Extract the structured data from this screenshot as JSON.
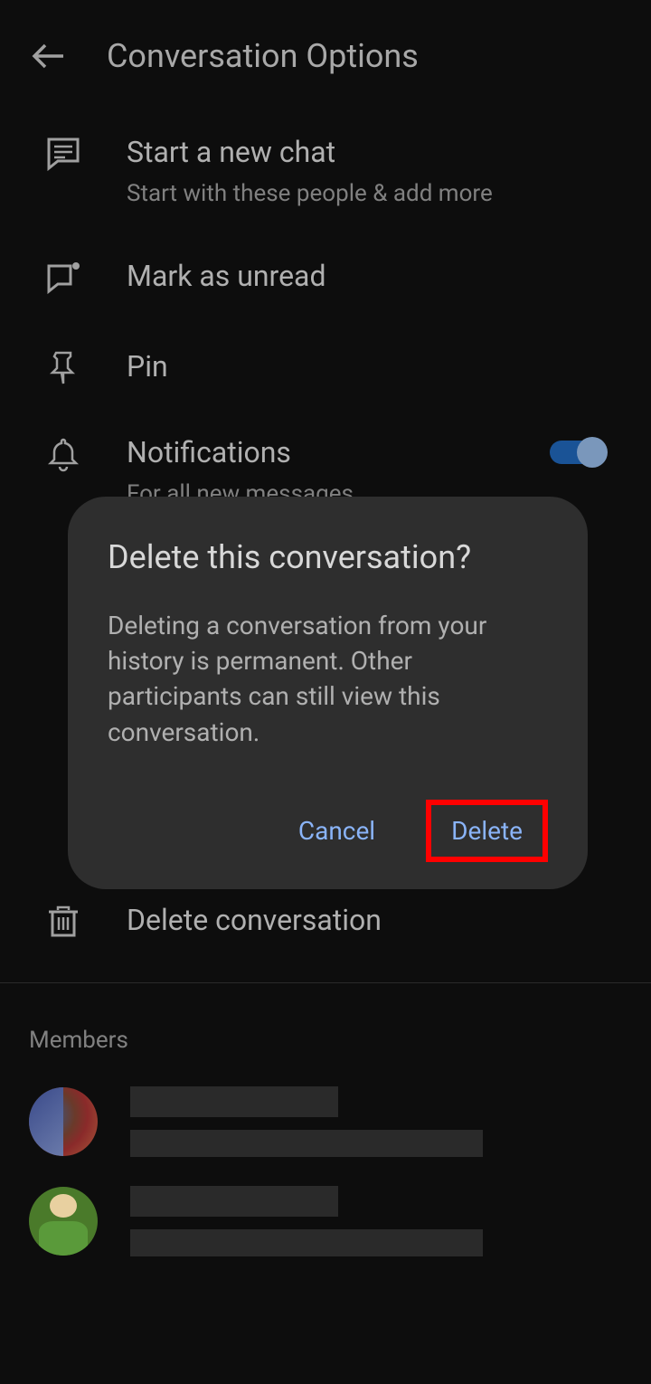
{
  "header": {
    "title": "Conversation Options"
  },
  "options": {
    "newChat": {
      "title": "Start a new chat",
      "subtitle": "Start with these people & add more"
    },
    "markUnread": {
      "title": "Mark as unread"
    },
    "pin": {
      "title": "Pin"
    },
    "notifications": {
      "title": "Notifications",
      "subtitle": "For all new messages"
    },
    "deleteConversation": {
      "title": "Delete conversation"
    }
  },
  "sections": {
    "members": "Members"
  },
  "dialog": {
    "title": "Delete this conversation?",
    "body": "Deleting a conversation from your history is permanent. Other participants can still view this conversation.",
    "cancel": "Cancel",
    "delete": "Delete"
  }
}
